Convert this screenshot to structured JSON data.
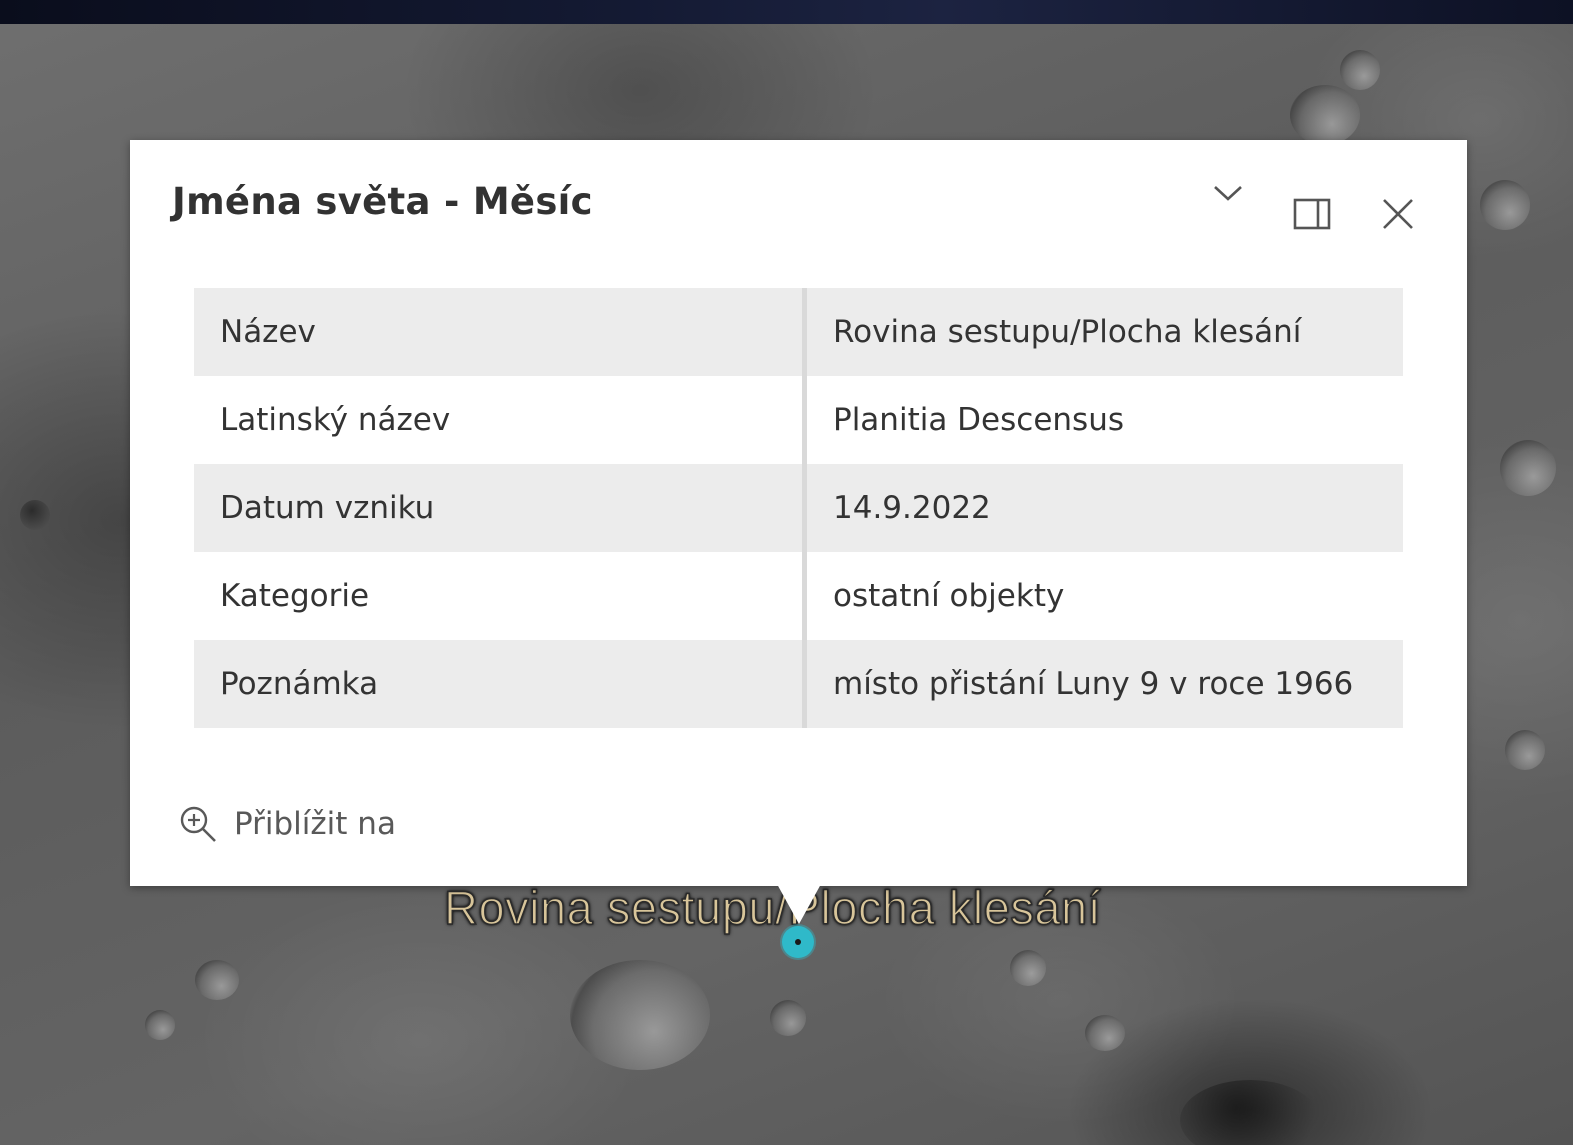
{
  "popup": {
    "title": "Jména světa - Měsíc",
    "attributes": [
      {
        "key": "Název",
        "value": "Rovina sestupu/Plocha klesání"
      },
      {
        "key": "Latinský název",
        "value": "Planitia Descensus"
      },
      {
        "key": "Datum vzniku",
        "value": "14.9.2022"
      },
      {
        "key": "Kategorie",
        "value": "ostatní objekty"
      },
      {
        "key": "Poznámka",
        "value": "místo přistání Luny 9 v roce 1966"
      }
    ],
    "zoom_action": {
      "label": "Přiblížit na",
      "icon": "zoom-in-icon"
    },
    "header_icons": [
      "chevron-down-icon",
      "dock-icon",
      "close-icon"
    ]
  },
  "map": {
    "feature_label": "Rovina sestupu/Plocha klesání",
    "marker_color": "#2fb9c9",
    "label_color": "#d8c59a"
  }
}
